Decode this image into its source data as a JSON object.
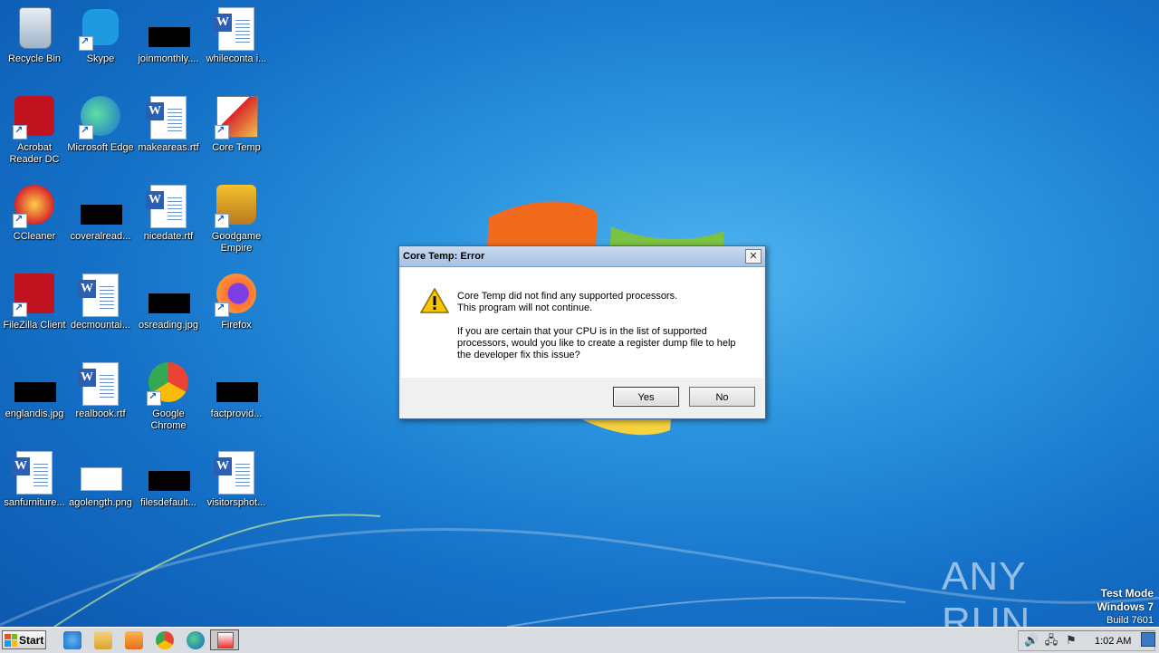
{
  "desktop": {
    "icons": [
      {
        "label": "Recycle Bin",
        "icon": "recycle-bin-icon"
      },
      {
        "label": "Skype",
        "icon": "skype-icon"
      },
      {
        "label": "joinmonthly....",
        "icon": "redacted-file-icon"
      },
      {
        "label": "whileconta i...",
        "icon": "word-doc-icon"
      },
      {
        "label": "Acrobat Reader DC",
        "icon": "acrobat-icon"
      },
      {
        "label": "Microsoft Edge",
        "icon": "edge-icon"
      },
      {
        "label": "makeareas.rtf",
        "icon": "word-doc-icon"
      },
      {
        "label": "Core Temp",
        "icon": "core-temp-icon"
      },
      {
        "label": "CCleaner",
        "icon": "ccleaner-icon"
      },
      {
        "label": "coveralread...",
        "icon": "redacted-file-icon"
      },
      {
        "label": "nicedate.rtf",
        "icon": "word-doc-icon"
      },
      {
        "label": "Goodgame Empire",
        "icon": "goodgame-empire-icon"
      },
      {
        "label": "FileZilla Client",
        "icon": "filezilla-icon"
      },
      {
        "label": "decmountai...",
        "icon": "word-doc-icon"
      },
      {
        "label": "osreading.jpg",
        "icon": "redacted-file-icon"
      },
      {
        "label": "Firefox",
        "icon": "firefox-icon"
      },
      {
        "label": "englandis.jpg",
        "icon": "redacted-file-icon"
      },
      {
        "label": "realbook.rtf",
        "icon": "word-doc-icon"
      },
      {
        "label": "Google Chrome",
        "icon": "chrome-icon"
      },
      {
        "label": "factprovid...",
        "icon": "redacted-file-icon"
      },
      {
        "label": "sanfurniture...",
        "icon": "word-doc-icon"
      },
      {
        "label": "agolength.png",
        "icon": "image-file-icon"
      },
      {
        "label": "filesdefault...",
        "icon": "redacted-file-icon"
      },
      {
        "label": "visitorsphot...",
        "icon": "word-doc-icon"
      }
    ]
  },
  "dialog": {
    "title": "Core Temp: Error",
    "line1": "Core Temp did not find any supported processors.",
    "line2": "This program will not continue.",
    "line3": "If you are certain that your CPU is in the list of supported",
    "line4": "processors, would you like to create a register dump file to help",
    "line5": "the developer fix this issue?",
    "yes_label": "Yes",
    "no_label": "No",
    "close_glyph": "✕"
  },
  "watermark": {
    "brand": "ANY RUN",
    "mode": "Test Mode",
    "os": "Windows 7",
    "build": "Build 7601"
  },
  "taskbar": {
    "start_label": "Start",
    "clock": "1:02 AM"
  }
}
